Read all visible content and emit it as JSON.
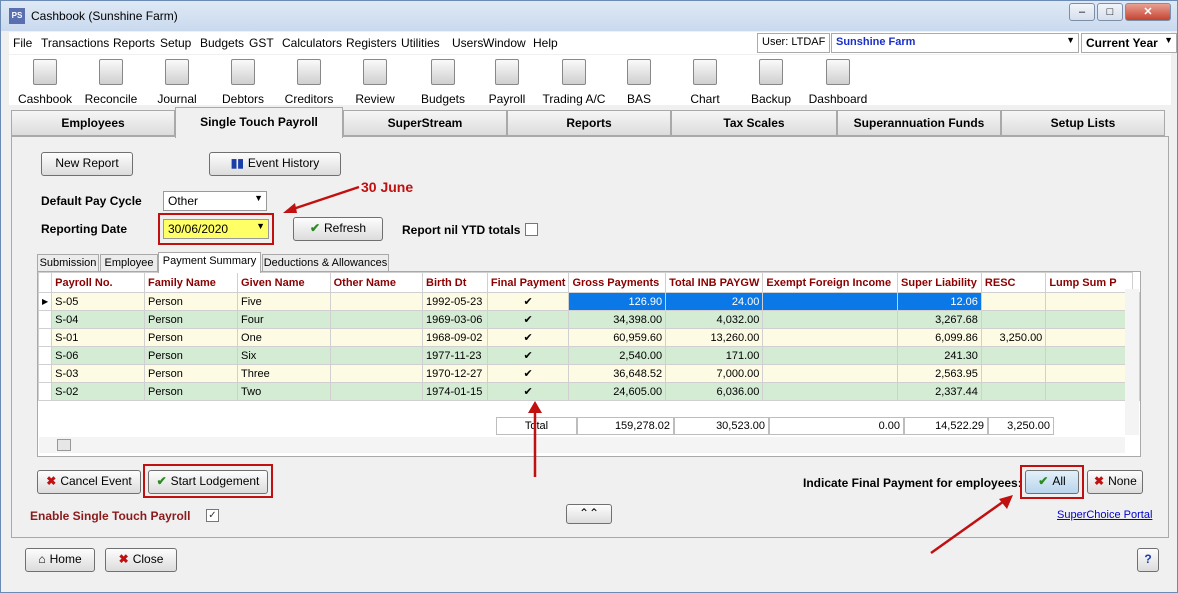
{
  "window": {
    "title": "Cashbook (Sunshine Farm)",
    "app_icon": "PS"
  },
  "menu": [
    "File",
    "Transactions",
    "Reports",
    "Setup",
    "Budgets",
    "GST",
    "Calculators",
    "Registers",
    "Utilities",
    "Users",
    "Window",
    "Help"
  ],
  "user": {
    "label": "User: LTDAF",
    "farm": "Sunshine Farm",
    "period": "Current Year"
  },
  "toolbar": [
    "Cashbook",
    "Reconcile",
    "Journal",
    "Debtors",
    "Creditors",
    "Review",
    "Budgets",
    "Payroll",
    "Trading A/C",
    "BAS",
    "Chart",
    "Backup",
    "Dashboard"
  ],
  "tabs": [
    "Employees",
    "Single Touch Payroll",
    "SuperStream",
    "Reports",
    "Tax Scales",
    "Superannuation Funds",
    "Setup Lists"
  ],
  "buttons": {
    "new_report": "New Report",
    "event_history": "Event History",
    "refresh": "Refresh",
    "cancel_event": "Cancel Event",
    "start_lodgement": "Start Lodgement",
    "all": "All",
    "none": "None",
    "home": "Home",
    "close": "Close"
  },
  "form": {
    "default_pay_cycle_label": "Default Pay Cycle",
    "default_pay_cycle_value": "Other",
    "reporting_date_label": "Reporting Date",
    "reporting_date_value": "30/06/2020",
    "report_nil_label": "Report nil YTD totals",
    "annotation": "30 June"
  },
  "subtabs": [
    "Submission",
    "Employee",
    "Payment Summary",
    "Deductions & Allowances"
  ],
  "grid": {
    "columns": [
      "Payroll No.",
      "Family Name",
      "Given Name",
      "Other Name",
      "Birth Dt",
      "Final Payment",
      "Gross Payments",
      "Total INB PAYGW",
      "Exempt Foreign Income",
      "Super Liability",
      "RESC",
      "Lump Sum P"
    ],
    "rows": [
      [
        "S-05",
        "Person",
        "Five",
        "",
        "1992-05-23",
        "✔",
        "126.90",
        "24.00",
        "",
        "12.06",
        "",
        ""
      ],
      [
        "S-04",
        "Person",
        "Four",
        "",
        "1969-03-06",
        "✔",
        "34,398.00",
        "4,032.00",
        "",
        "3,267.68",
        "",
        ""
      ],
      [
        "S-01",
        "Person",
        "One",
        "",
        "1968-09-02",
        "✔",
        "60,959.60",
        "13,260.00",
        "",
        "6,099.86",
        "3,250.00",
        ""
      ],
      [
        "S-06",
        "Person",
        "Six",
        "",
        "1977-11-23",
        "✔",
        "2,540.00",
        "171.00",
        "",
        "241.30",
        "",
        ""
      ],
      [
        "S-03",
        "Person",
        "Three",
        "",
        "1970-12-27",
        "✔",
        "36,648.52",
        "7,000.00",
        "",
        "2,563.95",
        "",
        ""
      ],
      [
        "S-02",
        "Person",
        "Two",
        "",
        "1974-01-15",
        "✔",
        "24,605.00",
        "6,036.00",
        "",
        "2,337.44",
        "",
        ""
      ]
    ],
    "totals": {
      "label": "Total",
      "gross": "159,278.02",
      "inb": "30,523.00",
      "exempt": "0.00",
      "super": "14,522.29",
      "resc": "3,250.00"
    }
  },
  "footer": {
    "indicate_label": "Indicate Final Payment for employees:",
    "enable_label": "Enable Single Touch Payroll",
    "portal_link": "SuperChoice Portal",
    "help": "?"
  }
}
